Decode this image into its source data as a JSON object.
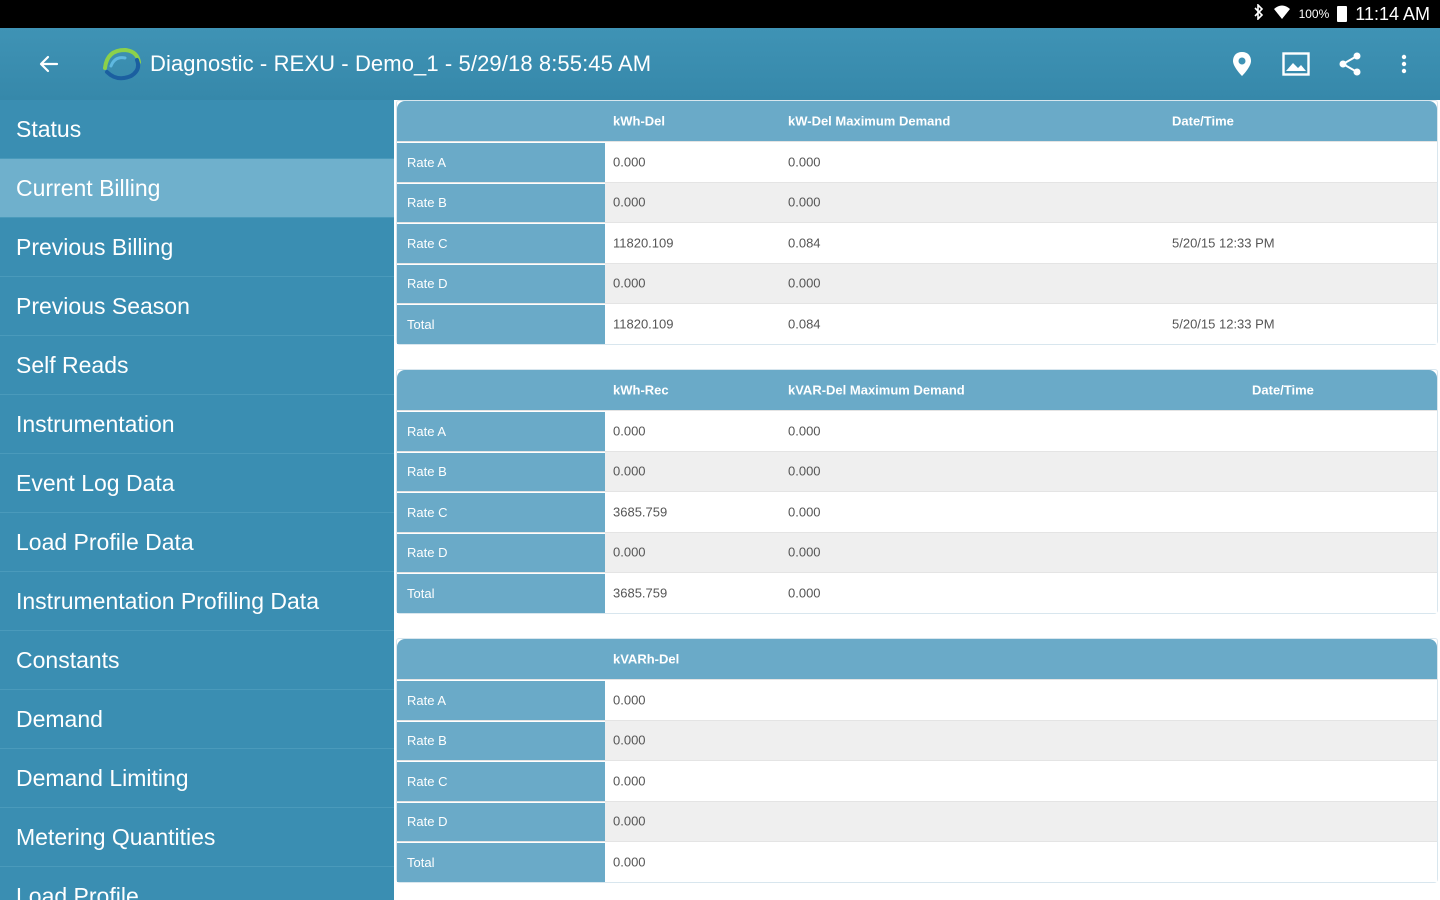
{
  "status_bar": {
    "bluetooth_icon": "bluetooth-icon",
    "wifi_icon": "wifi-icon",
    "battery_percent": "100%",
    "time": "11:14 AM"
  },
  "app_bar": {
    "title": "Diagnostic - REXU - Demo_1 - 5/29/18 8:55:45 AM"
  },
  "sidebar": {
    "items": [
      {
        "label": "Status"
      },
      {
        "label": "Current Billing",
        "active": true
      },
      {
        "label": "Previous Billing"
      },
      {
        "label": "Previous Season"
      },
      {
        "label": "Self Reads"
      },
      {
        "label": "Instrumentation"
      },
      {
        "label": "Event Log Data"
      },
      {
        "label": "Load Profile Data"
      },
      {
        "label": "Instrumentation Profiling Data"
      },
      {
        "label": "Constants"
      },
      {
        "label": "Demand"
      },
      {
        "label": "Demand Limiting"
      },
      {
        "label": "Metering Quantities"
      },
      {
        "label": "Load Profile"
      }
    ]
  },
  "tables": [
    {
      "headers": [
        "kWh-Del",
        "kW-Del Maximum Demand",
        "Date/Time"
      ],
      "rows": [
        {
          "label": "Rate A",
          "values": [
            "0.000",
            "0.000",
            ""
          ]
        },
        {
          "label": "Rate B",
          "values": [
            "0.000",
            "0.000",
            ""
          ]
        },
        {
          "label": "Rate C",
          "values": [
            "11820.109",
            "0.084",
            "5/20/15 12:33 PM"
          ]
        },
        {
          "label": "Rate D",
          "values": [
            "0.000",
            "0.000",
            ""
          ]
        },
        {
          "label": "Total",
          "values": [
            "11820.109",
            "0.084",
            "5/20/15 12:33 PM"
          ]
        }
      ]
    },
    {
      "headers": [
        "kWh-Rec",
        "kVAR-Del Maximum Demand",
        "Date/Time"
      ],
      "rows": [
        {
          "label": "Rate A",
          "values": [
            "0.000",
            "0.000",
            ""
          ]
        },
        {
          "label": "Rate B",
          "values": [
            "0.000",
            "0.000",
            ""
          ]
        },
        {
          "label": "Rate C",
          "values": [
            "3685.759",
            "0.000",
            ""
          ]
        },
        {
          "label": "Rate D",
          "values": [
            "0.000",
            "0.000",
            ""
          ]
        },
        {
          "label": "Total",
          "values": [
            "3685.759",
            "0.000",
            ""
          ]
        }
      ]
    },
    {
      "headers": [
        "kVARh-Del"
      ],
      "rows": [
        {
          "label": "Rate A",
          "values": [
            "0.000"
          ]
        },
        {
          "label": "Rate B",
          "values": [
            "0.000"
          ]
        },
        {
          "label": "Rate C",
          "values": [
            "0.000"
          ]
        },
        {
          "label": "Rate D",
          "values": [
            "0.000"
          ]
        },
        {
          "label": "Total",
          "values": [
            "0.000"
          ]
        }
      ]
    }
  ],
  "colors": {
    "app_bar": "#3f93b5",
    "sidebar": "#3a8eb2",
    "sidebar_active": "#6fb0cc",
    "table_header": "#6aaac8"
  }
}
